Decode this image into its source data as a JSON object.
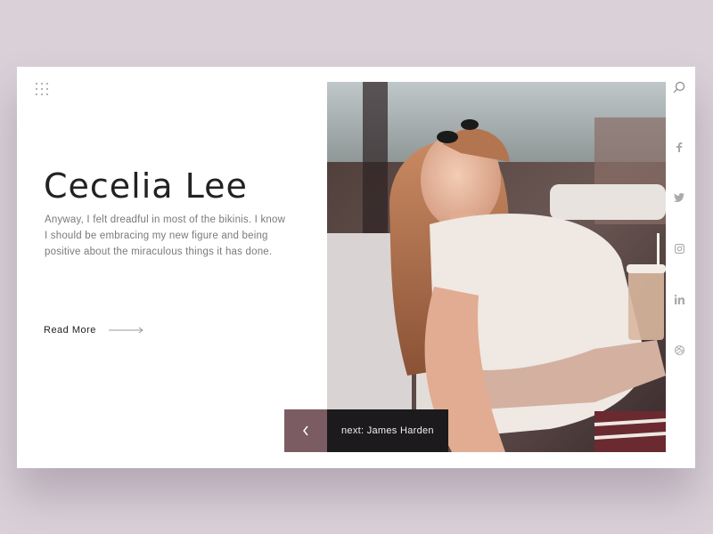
{
  "profile": {
    "name": "Cecelia Lee",
    "description": "Anyway, I felt dreadful in most of the bikinis. I know I should be embracing my new figure and being positive about the miraculous things it has done.",
    "read_more_label": "Read More"
  },
  "navigation": {
    "next_label": "next: James Harden"
  },
  "icons": {
    "menu": "grid-menu-icon",
    "search": "search-icon",
    "prev": "chevron-left-icon",
    "social": [
      "facebook-icon",
      "twitter-icon",
      "instagram-icon",
      "linkedin-icon",
      "dribbble-icon"
    ]
  },
  "colors": {
    "background": "#d9d0d8",
    "card": "#ffffff",
    "prev_button": "#7a5c62",
    "next_bar": "#1c1a1c",
    "title": "#222222",
    "body_text": "#7a7a7a"
  }
}
